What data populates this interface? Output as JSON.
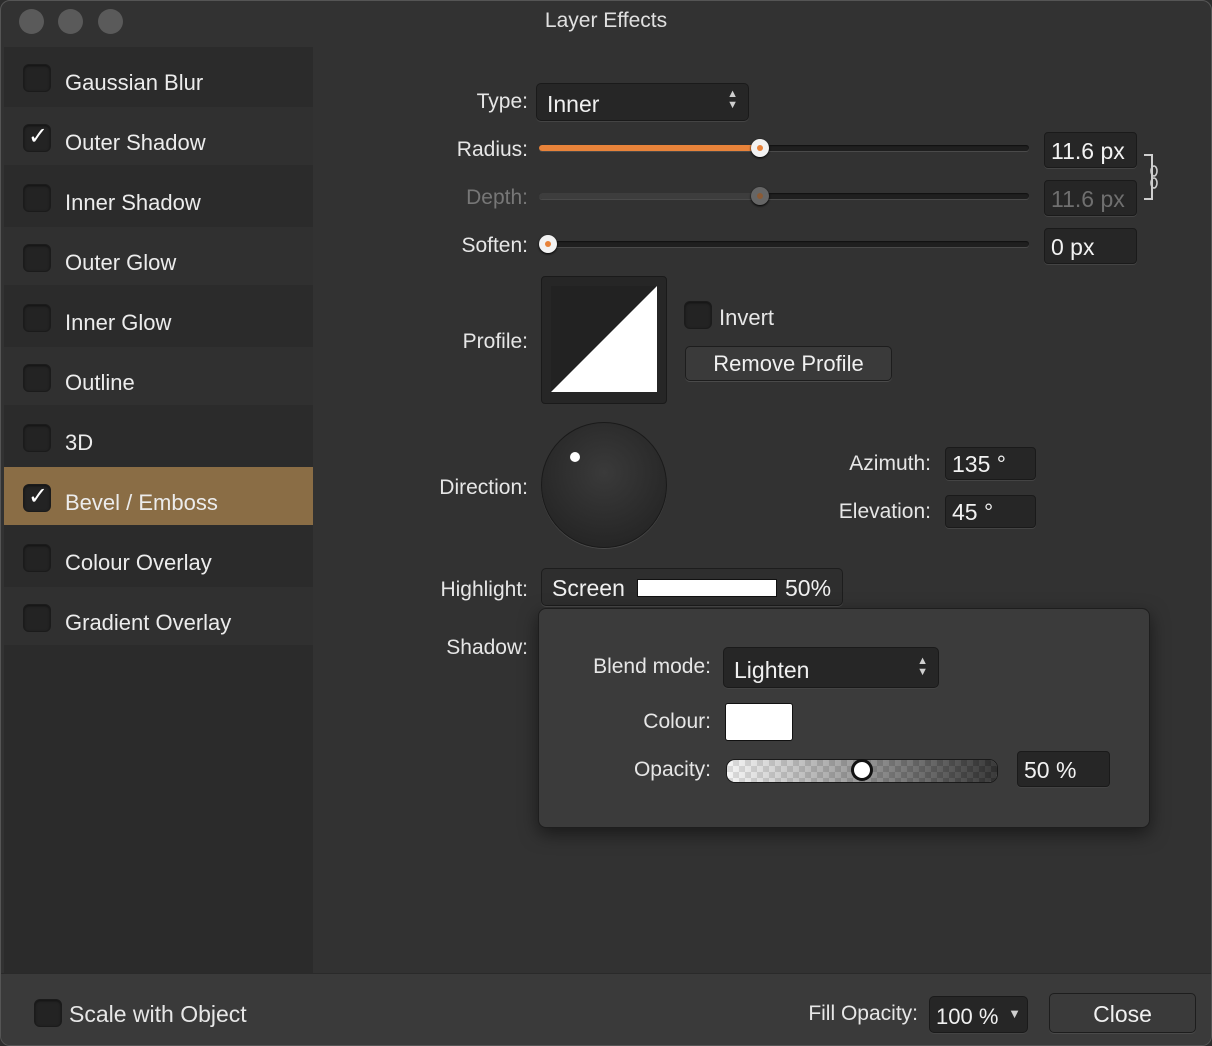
{
  "window": {
    "title": "Layer Effects"
  },
  "effects": [
    {
      "label": "Gaussian Blur",
      "checked": false
    },
    {
      "label": "Outer Shadow",
      "checked": true
    },
    {
      "label": "Inner Shadow",
      "checked": false
    },
    {
      "label": "Outer Glow",
      "checked": false
    },
    {
      "label": "Inner Glow",
      "checked": false
    },
    {
      "label": "Outline",
      "checked": false
    },
    {
      "label": "3D",
      "checked": false
    },
    {
      "label": "Bevel / Emboss",
      "checked": true,
      "selected": true
    },
    {
      "label": "Colour Overlay",
      "checked": false
    },
    {
      "label": "Gradient Overlay",
      "checked": false
    }
  ],
  "checkmark": "✓",
  "settings": {
    "type_label": "Type:",
    "type_value": "Inner",
    "radius_label": "Radius:",
    "radius_value": "11.6 px",
    "radius_fraction": 0.45,
    "depth_label": "Depth:",
    "depth_value": "11.6 px",
    "depth_fraction": 0.45,
    "soften_label": "Soften:",
    "soften_value": "0 px",
    "soften_fraction": 0.0,
    "profile_label": "Profile:",
    "invert_label": "Invert",
    "remove_profile_label": "Remove Profile",
    "direction_label": "Direction:",
    "azimuth_label": "Azimuth:",
    "azimuth_value": "135 °",
    "elevation_label": "Elevation:",
    "elevation_value": "45 °",
    "highlight_label": "Highlight:",
    "highlight_mode": "Screen",
    "highlight_opacity": "50%",
    "shadow_label": "Shadow:"
  },
  "shadow_popover": {
    "blend_mode_label": "Blend mode:",
    "blend_mode_value": "Lighten",
    "colour_label": "Colour:",
    "colour_value": "#ffffff",
    "opacity_label": "Opacity:",
    "opacity_value": "50 %",
    "opacity_fraction": 0.5
  },
  "footer": {
    "scale_label": "Scale with Object",
    "fill_opacity_label": "Fill Opacity:",
    "fill_opacity_value": "100 %",
    "close_label": "Close"
  },
  "colors": {
    "accent": "#e8833a",
    "selected_row": "#8a6d45"
  }
}
